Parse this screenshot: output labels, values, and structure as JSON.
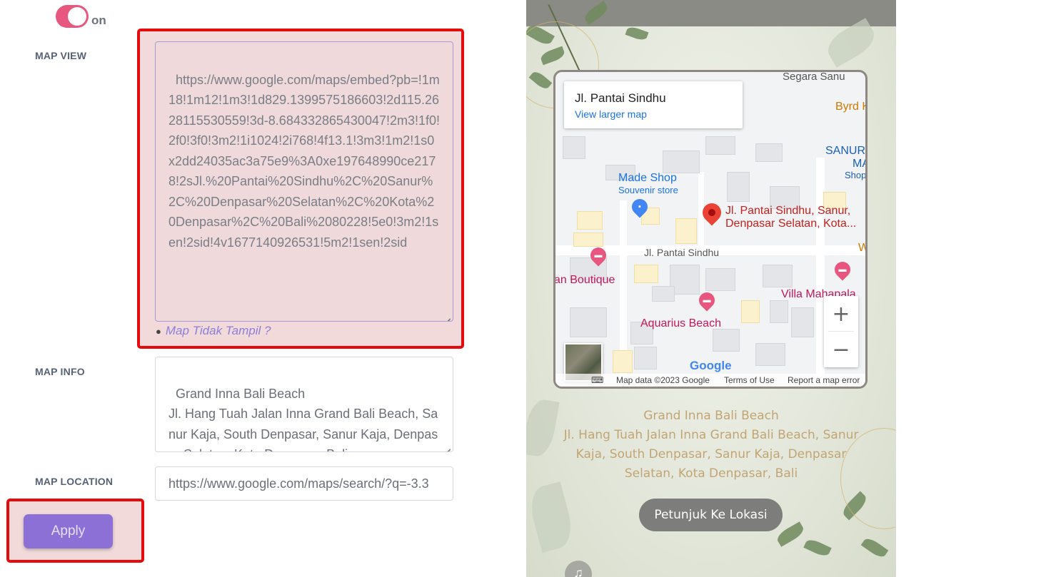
{
  "toggle": {
    "state_label": "on"
  },
  "map_view": {
    "label": "MAP VIEW",
    "value": "https://www.google.com/maps/embed?pb=!1m18!1m12!1m3!1d829.1399575186603!2d115.2628115530559!3d-8.684332865430047!2m3!1f0!2f0!3f0!3m2!1i1024!2i768!4f13.1!3m3!1m2!1s0x2dd24035ac3a75e9%3A0xe197648990ce2178!2sJl.%20Pantai%20Sindhu%2C%20Sanur%2C%20Denpasar%20Selatan%2C%20Kota%20Denpasar%2C%20Bali%2080228!5e0!3m2!1sen!2sid!4v1677140926531!5m2!1sen!2sid",
    "hint_bullet": "●",
    "hint_link": "Map Tidak Tampil ?"
  },
  "map_info": {
    "label": "MAP INFO",
    "value": "Grand Inna Bali Beach\nJl. Hang Tuah Jalan Inna Grand Bali Beach, Sanur Kaja, South Denpasar, Sanur Kaja, Denpasar Selatan, Kota Denpasar, Bali"
  },
  "map_location": {
    "label": "MAP LOCATION",
    "value": "https://www.google.com/maps/search/?q=-3.3"
  },
  "apply_label": "Apply",
  "preview": {
    "map": {
      "card_title": "Jl. Pantai Sindhu",
      "card_link": "View larger map",
      "labels": {
        "segara": "Segara Sanu",
        "byrd": "Byrd K",
        "sanur": "SANUR",
        "ma": "MA",
        "shop": "Shop",
        "made_shop": "Made Shop",
        "souvenir": "Souvenir store",
        "pin_line1": "Jl. Pantai Sindhu, Sanur,",
        "pin_line2": "Denpasar Selatan, Kota...",
        "road": "Jl. Pantai Sindhu",
        "w": "W",
        "boutique": "an Boutique",
        "villa": "Villa Mahapala",
        "aquarius": "Aquarius Beach"
      },
      "zoom_in": "+",
      "zoom_out": "−",
      "google": "Google",
      "attrib_data": "Map data ©2023 Google",
      "attrib_terms": "Terms of Use",
      "attrib_report": "Report a map error"
    },
    "loc_name": "Grand Inna Bali Beach",
    "loc_address": "Jl. Hang Tuah Jalan Inna Grand Bali Beach, Sanur Kaja, South Denpasar, Sanur Kaja, Denpasar Selatan, Kota Denpasar, Bali",
    "directions_label": "Petunjuk Ke Lokasi"
  },
  "colors": {
    "accent": "#8c70d6",
    "toggle": "#e8577e",
    "highlight": "#e50b0b",
    "pin": "#ea4335"
  }
}
